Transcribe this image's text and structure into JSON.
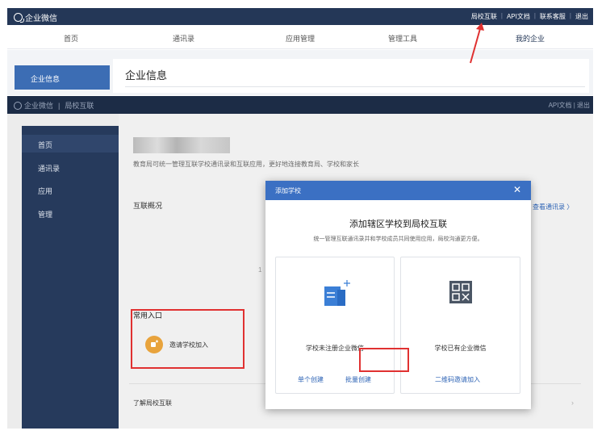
{
  "outer": {
    "app_name": "企业微信",
    "top_links": [
      "局校互联",
      "API文档",
      "联系客服",
      "退出"
    ],
    "nav": [
      "首页",
      "通讯录",
      "应用管理",
      "管理工具",
      "我的企业"
    ],
    "sidebar_active": "企业信息",
    "page_title": "企业信息"
  },
  "inner": {
    "app_name": "企业微信",
    "sub_name": "局校互联",
    "top_right": "API文档 | 退出",
    "sidebar": [
      "首页",
      "通讯录",
      "应用",
      "管理"
    ],
    "description": "教育局可统一管理互联学校通讯录和互联应用，更好地连接教育局、学校和家长",
    "section_overview": "互联概况",
    "view_contacts_link": "查看通讯录 〉",
    "mid_char": "1",
    "section_common": "常用入口",
    "invite_label": "邀请学校加入",
    "about_link": "了解局校互联",
    "chevron": "›"
  },
  "modal": {
    "header_title": "添加学校",
    "close": "✕",
    "title": "添加辖区学校到局校互联",
    "subtitle": "统一管理互联通讯录并和学校成员共同使用应用，局校沟通更方便。",
    "left_card": {
      "label": "学校未注册企业微信",
      "link_single": "单个创建",
      "link_batch": "批量创建"
    },
    "right_card": {
      "label": "学校已有企业微信",
      "link_qr": "二维码邀请加入"
    }
  },
  "colors": {
    "outer_topbar": "#243757",
    "inner_topbar": "#1c2c46",
    "inner_sidebar": "#263a5c",
    "accent_blue": "#3b70c3",
    "link_blue": "#2d63b5",
    "annotation_red": "#e03131",
    "invite_icon": "#e8a33c"
  }
}
